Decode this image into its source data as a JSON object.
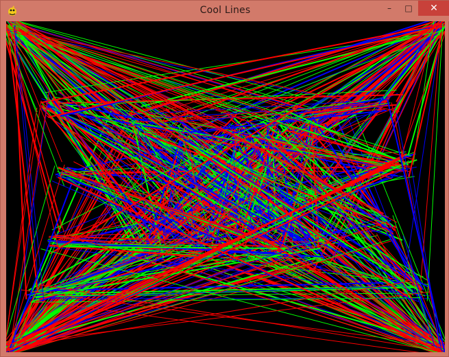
{
  "window": {
    "title": "Cool Lines",
    "minimize_symbol": "–",
    "maximize_symbol": "□",
    "close_symbol": "✕",
    "icon_name": "pygame-snake-icon"
  },
  "canvas": {
    "background": "#000000",
    "colors": {
      "red": "#ff0000",
      "green": "#00ff00",
      "blue": "#0000ff"
    }
  }
}
